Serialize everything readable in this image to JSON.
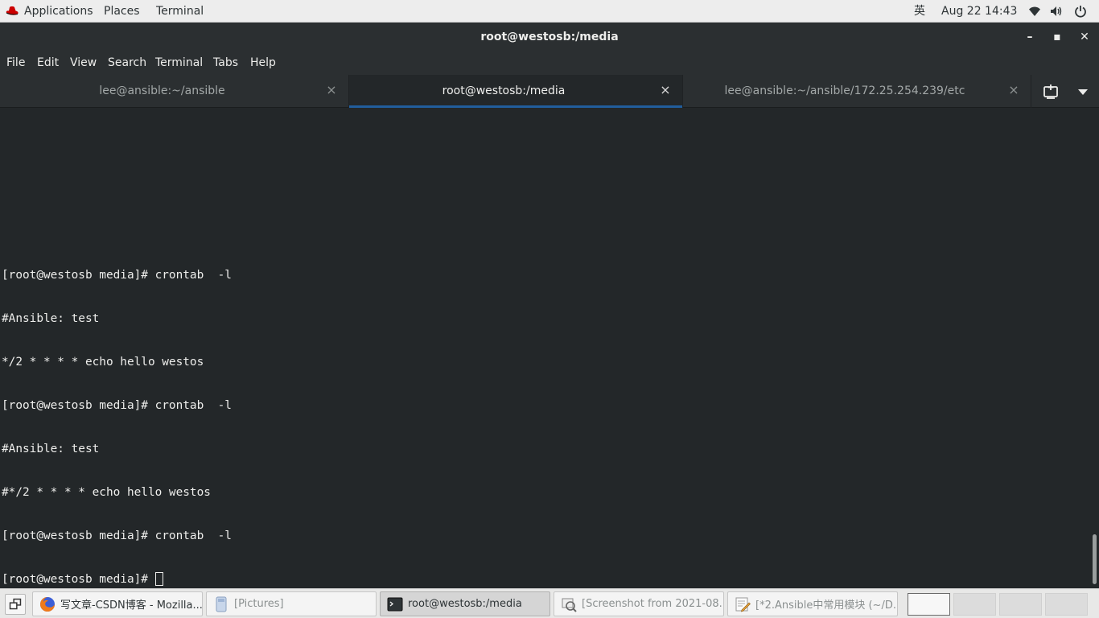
{
  "top_panel": {
    "applications": "Applications",
    "places": "Places",
    "terminal": "Terminal",
    "input_method": "英",
    "clock": "Aug 22  14:43",
    "icons": [
      "wifi-icon",
      "volume-icon",
      "power-icon"
    ]
  },
  "window": {
    "title": "root@westosb:/media",
    "controls": {
      "minimize": "–",
      "maximize": "▪",
      "close": "✕"
    }
  },
  "menubar": [
    "File",
    "Edit",
    "View",
    "Search",
    "Terminal",
    "Tabs",
    "Help"
  ],
  "tabs": [
    {
      "label": "lee@ansible:~/ansible",
      "active": false
    },
    {
      "label": "root@westosb:/media",
      "active": true
    },
    {
      "label": "lee@ansible:~/ansible/172.25.254.239/etc",
      "active": false
    }
  ],
  "tab_close_glyph": "×",
  "terminal": {
    "lines": [
      "[root@westosb media]# crontab  -l",
      "#Ansible: test",
      "*/2 * * * * echo hello westos",
      "[root@westosb media]# crontab  -l",
      "#Ansible: test",
      "#*/2 * * * * echo hello westos",
      "[root@westosb media]# crontab  -l",
      "[root@westosb media]# "
    ],
    "colors": {
      "background": "#232729",
      "foreground": "#eeeeec"
    }
  },
  "taskbar": {
    "tasks": [
      {
        "label": "写文章-CSDN博客 - Mozilla...",
        "icon": "firefox-icon"
      },
      {
        "label": "[Pictures]",
        "icon": "file-manager-icon"
      },
      {
        "label": "root@westosb:/media",
        "icon": "terminal-icon"
      },
      {
        "label": "[Screenshot from 2021-08...",
        "icon": "screenshot-icon"
      },
      {
        "label": "[*2.Ansible中常用模块 (~/D...",
        "icon": "text-editor-icon"
      }
    ],
    "workspaces": 4,
    "active_workspace": 1
  },
  "accent_color": "#215d9c"
}
